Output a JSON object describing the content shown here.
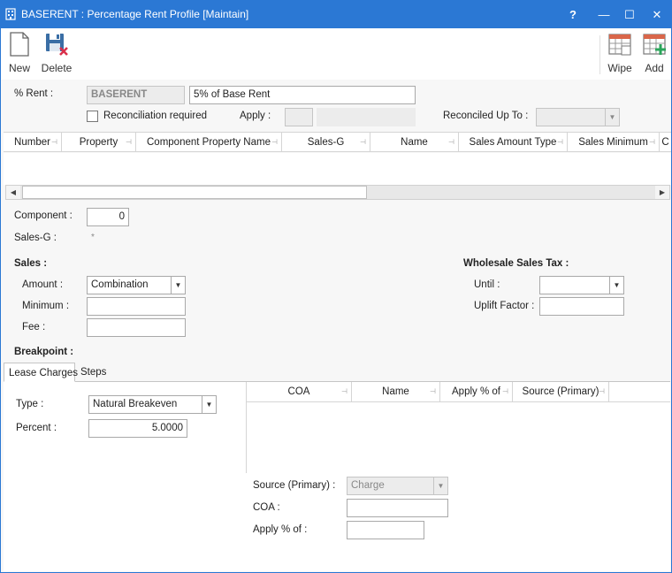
{
  "window": {
    "title": "BASERENT : Percentage Rent Profile [Maintain]",
    "help": "?",
    "minimize": "—",
    "maximize": "☐",
    "close": "✕"
  },
  "toolbar": {
    "new_label": "New",
    "delete_label": "Delete",
    "wipe_label": "Wipe",
    "add_label": "Add"
  },
  "header": {
    "rent_label": "% Rent :",
    "rent_code": "BASERENT",
    "rent_description": "5% of Base Rent",
    "reconciliation_label": "Reconciliation required",
    "reconciliation_checked": false,
    "apply_label": "Apply :",
    "apply_value": "",
    "apply_text": "",
    "reconciled_up_to_label": "Reconciled Up To :",
    "reconciled_up_to_value": ""
  },
  "component_grid": {
    "columns": [
      "Number",
      "Property",
      "Component Property Name",
      "Sales-G",
      "Name",
      "Sales Amount Type",
      "Sales Minimum",
      "C"
    ],
    "rows": []
  },
  "component": {
    "component_label": "Component :",
    "component_value": "0",
    "sales_g_label": "Sales-G :",
    "sales_g_value": "*"
  },
  "sales": {
    "section_label": "Sales :",
    "amount_label": "Amount :",
    "amount_value": "Combination",
    "minimum_label": "Minimum :",
    "minimum_value": "",
    "fee_label": "Fee :",
    "fee_value": ""
  },
  "wholesale": {
    "section_label": "Wholesale Sales Tax :",
    "until_label": "Until :",
    "until_value": "",
    "uplift_label": "Uplift Factor :",
    "uplift_value": ""
  },
  "breakpoint": {
    "section_label": "Breakpoint :",
    "tabs": [
      "Lease Charges",
      "Steps"
    ],
    "type_label": "Type :",
    "type_value": "Natural Breakeven",
    "percent_label": "Percent :",
    "percent_value": "5.0000",
    "charges_columns": [
      "COA",
      "Name",
      "Apply % of",
      "Source (Primary)"
    ],
    "source_label": "Source (Primary) :",
    "source_value": "Charge",
    "coa_label": "COA :",
    "coa_value": "",
    "apply_pct_label": "Apply % of :",
    "apply_pct_value": ""
  }
}
